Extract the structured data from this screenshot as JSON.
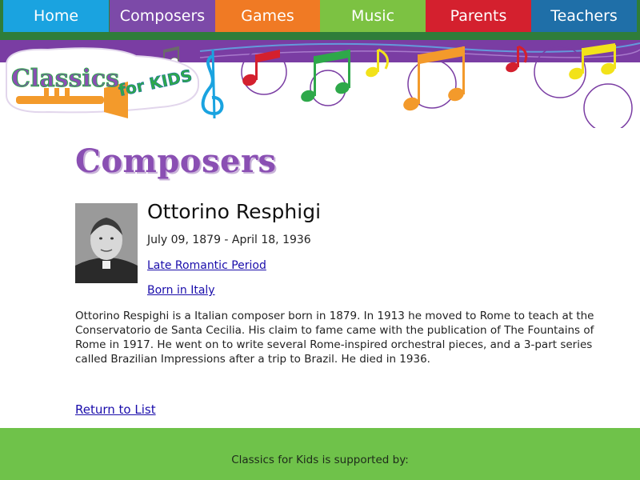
{
  "nav": {
    "items": [
      {
        "label": "Home",
        "color": "#1aa3e0"
      },
      {
        "label": "Composers",
        "color": "#7c4aa8"
      },
      {
        "label": "Games",
        "color": "#f07a24"
      },
      {
        "label": "Music",
        "color": "#7cc242"
      },
      {
        "label": "Parents",
        "color": "#d4202e"
      },
      {
        "label": "Teachers",
        "color": "#1f6fa8"
      }
    ]
  },
  "banner": {
    "logo_text": "Classics",
    "logo_sub": "for KIDS",
    "icon": "trumpet-icon"
  },
  "page": {
    "heading": "Composers"
  },
  "composer": {
    "name": "Ottorino Resphigi",
    "dates": "July 09, 1879 - April 18, 1936",
    "period": "Late Romantic Period",
    "country": "Born in Italy",
    "bio": "Ottorino Respighi is a Italian composer born in 1879. In 1913 he moved to Rome to teach at the Conservatorio de Santa Cecilia. His claim to fame came with the publication of The Fountains of Rome in 1917. He went on to write several Rome-inspired orchestral pieces, and a 3-part series called Brazilian Impressions after a trip to Brazil. He died in 1936."
  },
  "links": {
    "return": "Return to List"
  },
  "footer": {
    "text": "Classics for Kids is supported by:"
  },
  "colors": {
    "nav_bg": "#2f7d3a",
    "banner_purple": "#7a3da3",
    "heading_purple": "#8a4fb3",
    "footer_green": "#6fc24a",
    "link_blue": "#1a0dab"
  }
}
